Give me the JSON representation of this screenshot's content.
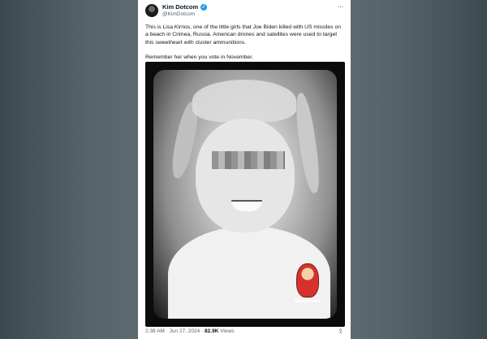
{
  "tweet": {
    "author_name": "Kim Dotcom",
    "handle": "@KimDotcom",
    "verified_icon": "✓",
    "more_icon": "···",
    "paragraphs": [
      "This is Lisa Kirnos, one of the little girls that Joe Biden killed with US missiles on a beach in Crimea, Russia. American drones and satellites were used to target this sweetheart with cluster ammunitions.",
      "Remember her when you vote in November."
    ],
    "image_badge": "Матрёшка",
    "time": "2:38 AM",
    "separator": "·",
    "date": "Jun 27, 2024",
    "views_count": "82.9K",
    "views_label": "Views",
    "share_icon": "⇪"
  },
  "colors": {
    "background": "#5a666d",
    "card": "#ffffff",
    "text": "#0f1419",
    "muted": "#536471",
    "verified": "#1d9bf0"
  }
}
